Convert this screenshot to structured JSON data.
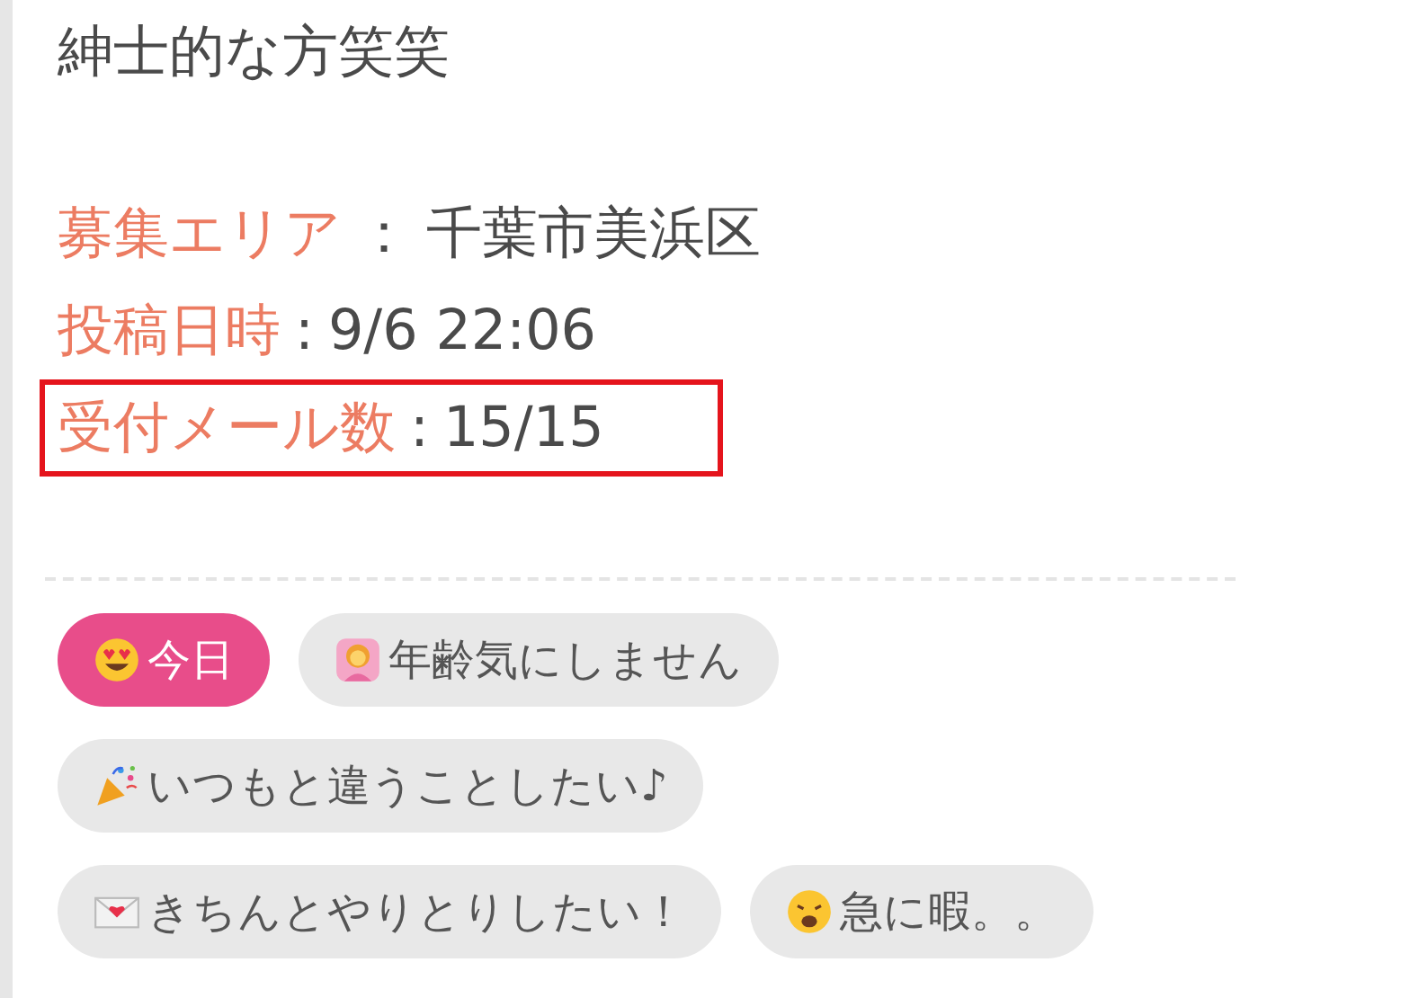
{
  "title": "紳士的な方笑笑",
  "info": [
    {
      "label": "募集エリア",
      "separator": "：",
      "value": "千葉市美浜区",
      "highlighted": false
    },
    {
      "label": "投稿日時",
      "separator": ":",
      "value": "9/6 22:06",
      "highlighted": false
    },
    {
      "label": "受付メール数",
      "separator": ":",
      "value": "15/15",
      "highlighted": true
    }
  ],
  "tags": [
    {
      "kind": "heart-eyes",
      "label": "今日",
      "selected": true
    },
    {
      "kind": "figure",
      "label": "年齢気にしません",
      "selected": false
    },
    {
      "kind": "party",
      "label": "いつもと違うことしたい♪",
      "selected": false
    },
    {
      "kind": "letter",
      "label": "きちんとやりとりしたい！",
      "selected": false
    },
    {
      "kind": "weary",
      "label": "急に暇。。",
      "selected": false
    }
  ]
}
